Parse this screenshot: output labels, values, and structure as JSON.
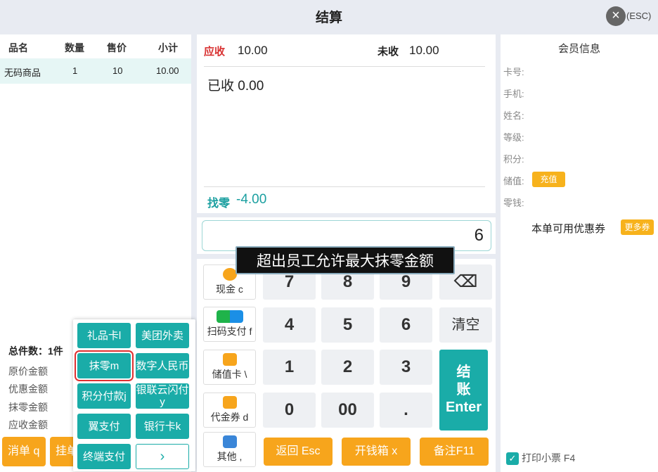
{
  "window": {
    "title": "结算",
    "esc_label": "(ESC)"
  },
  "cart": {
    "headers": [
      "品名",
      "数量",
      "售价",
      "小计"
    ],
    "rows": [
      {
        "name": "无码商品",
        "qty": "1",
        "price": "10",
        "subtotal": "10.00"
      }
    ],
    "summary": {
      "total_count": "总件数：1件",
      "original_amount": "原价金额",
      "discount_amount": "优惠金额",
      "rounding_amount": "抹零金额",
      "receivable_amount": "应收金额"
    },
    "buttons": {
      "cancel": "消单 q",
      "hold": "挂单"
    }
  },
  "popup": {
    "items": [
      "礼品卡l",
      "美团外卖",
      "抹零m",
      "数字人民币",
      "积分付款j",
      "银联云闪付y",
      "翼支付",
      "银行卡k",
      "终端支付"
    ],
    "next": "›"
  },
  "amounts": {
    "due_label": "应收",
    "due_value": "10.00",
    "unpaid_label": "未收",
    "unpaid_value": "10.00",
    "paid_text": "已收 0.00",
    "change_label": "找零",
    "change_value": "-4.00"
  },
  "input": {
    "value": "6"
  },
  "tooltip": "超出员工允许最大抹零金额",
  "keypad": {
    "pay_methods": [
      "现金 c",
      "扫码支付 f",
      "储值卡 \\",
      "代金券 d",
      "其他 ,"
    ],
    "keys": [
      "7",
      "8",
      "9",
      "4",
      "5",
      "6",
      "1",
      "2",
      "3",
      "0",
      "00",
      "."
    ],
    "clear": "清空",
    "backspace": "⌫",
    "checkout_line1": "结",
    "checkout_line2": "账",
    "checkout_line3": "Enter",
    "actions": [
      "返回 Esc",
      "开钱箱 x",
      "备注F11"
    ]
  },
  "member": {
    "title": "会员信息",
    "fields": [
      "卡号:",
      "手机:",
      "姓名:",
      "等级:",
      "积分:",
      "储值:",
      "零钱:"
    ],
    "recharge_badge": "充值",
    "coupon_label": "本单可用优惠券",
    "more_badge": "更多券",
    "print_label": "打印小票 F4"
  },
  "colors": {
    "accent": "#1aaca8",
    "orange": "#f7a51c",
    "due_red": "#d83030"
  }
}
